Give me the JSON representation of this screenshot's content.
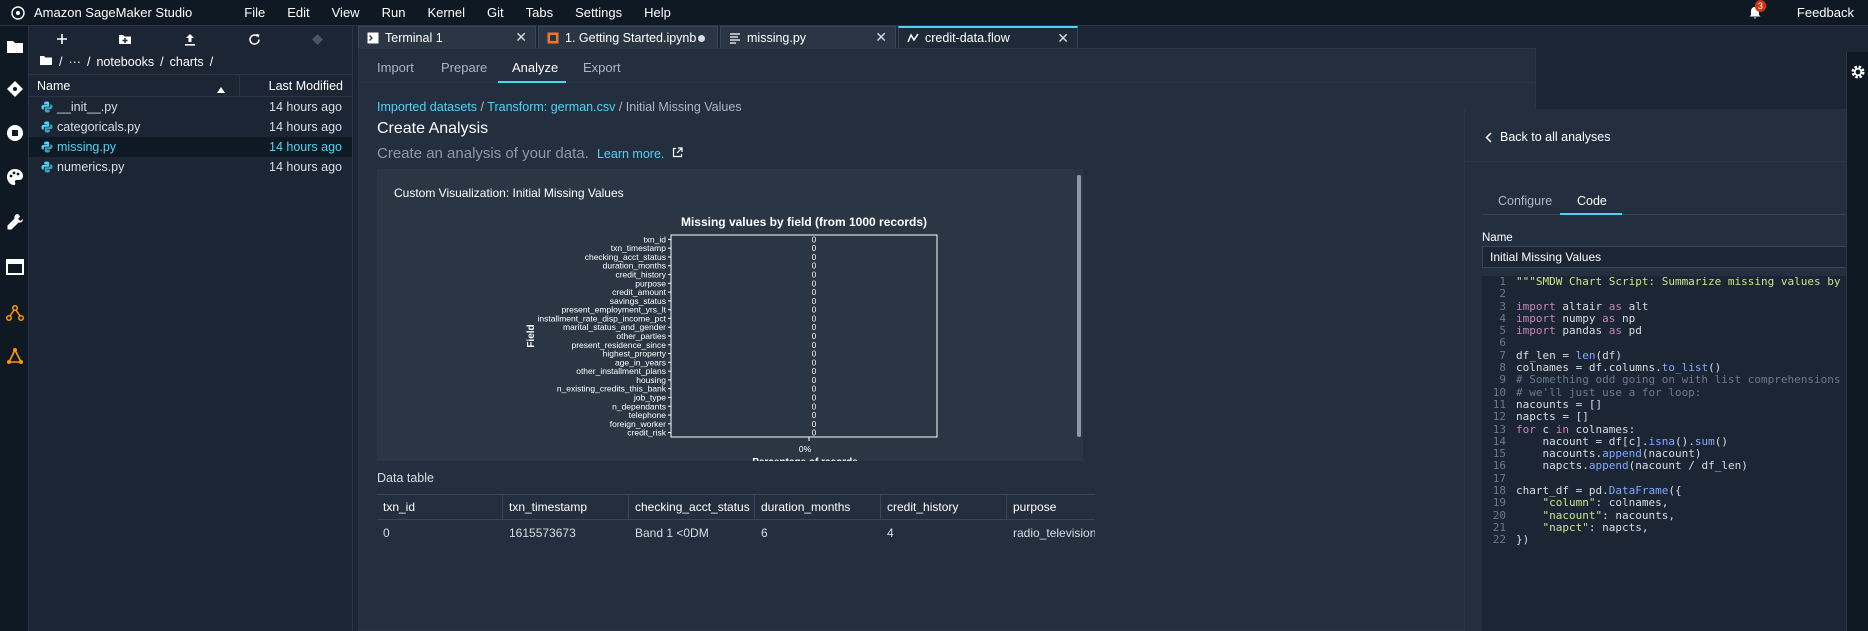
{
  "app": {
    "title": "Amazon SageMaker Studio",
    "feedback": "Feedback",
    "notifications": "3"
  },
  "menu": [
    "File",
    "Edit",
    "View",
    "Run",
    "Kernel",
    "Git",
    "Tabs",
    "Settings",
    "Help"
  ],
  "filebrowser": {
    "crumbs": [
      "/",
      "···",
      "/",
      "notebooks",
      "/",
      "charts",
      "/"
    ],
    "header": {
      "name": "Name",
      "modified": "Last Modified"
    },
    "files": [
      {
        "name": "__init__.py",
        "modified": "14 hours ago",
        "selected": false
      },
      {
        "name": "categoricals.py",
        "modified": "14 hours ago",
        "selected": false
      },
      {
        "name": "missing.py",
        "modified": "14 hours ago",
        "selected": true
      },
      {
        "name": "numerics.py",
        "modified": "14 hours ago",
        "selected": false
      }
    ]
  },
  "tabs": [
    {
      "label": "Terminal 1"
    },
    {
      "label": "1. Getting Started.ipynb"
    },
    {
      "label": "missing.py"
    },
    {
      "label": "credit-data.flow"
    }
  ],
  "flow": {
    "subtabs": [
      "Import",
      "Prepare",
      "Analyze",
      "Export"
    ],
    "breadcrumb": {
      "a": "Imported datasets",
      "b": "Transform: german.csv",
      "c": "Initial Missing Values"
    },
    "heading": "Create Analysis",
    "subheading": "Create an analysis of your data.",
    "learn_more": "Learn more.",
    "viz_title": "Custom Visualization: Initial Missing Values",
    "data_table_label": "Data table",
    "table": {
      "columns": [
        "txn_id",
        "txn_timestamp",
        "checking_acct_status",
        "duration_months",
        "credit_history",
        "purpose"
      ],
      "rows": [
        [
          "0",
          "1615573673",
          "Band 1 <0DM",
          "6",
          "4",
          "radio_television"
        ]
      ]
    }
  },
  "chart_data": {
    "type": "bar",
    "title": "Missing values by field (from 1000 records)",
    "xlabel": "Percentage of records",
    "ylabel": "Field",
    "xticks": [
      "0%"
    ],
    "categories": [
      "txn_id",
      "txn_timestamp",
      "checking_acct_status",
      "duration_months",
      "credit_history",
      "purpose",
      "credit_amount",
      "savings_status",
      "present_employment_yrs_lt",
      "installment_rate_disp_income_pct",
      "marital_status_and_gender",
      "other_parties",
      "present_residence_since",
      "highest_property",
      "age_in_years",
      "other_installment_plans",
      "housing",
      "n_existing_credits_this_bank",
      "job_type",
      "n_dependants",
      "telephone",
      "foreign_worker",
      "credit_risk"
    ],
    "values": [
      0,
      0,
      0,
      0,
      0,
      0,
      0,
      0,
      0,
      0,
      0,
      0,
      0,
      0,
      0,
      0,
      0,
      0,
      0,
      0,
      0,
      0,
      0
    ],
    "data_labels": [
      "0",
      "0",
      "0",
      "0",
      "0",
      "0",
      "0",
      "0",
      "0",
      "0",
      "0",
      "0",
      "0",
      "0",
      "0",
      "0",
      "0",
      "0",
      "0",
      "0",
      "0",
      "0",
      "0"
    ]
  },
  "analysis": {
    "back": "Back to all analyses",
    "tabs": [
      "Configure",
      "Code"
    ],
    "name_label": "Name",
    "name_value": "Initial Missing Values",
    "code": [
      "\"\"\"SMDW Chart Script: Summarize missing values by column\"\"\"",
      "",
      "import altair as alt",
      "import numpy as np",
      "import pandas as pd",
      "",
      "df_len = len(df)",
      "colnames = df.columns.to_list()",
      "# Something odd going on with list comprehensions throwing",
      "# we'll just use a for loop:",
      "nacounts = []",
      "napcts = []",
      "for c in colnames:",
      "    nacount = df[c].isna().sum()",
      "    nacounts.append(nacount)",
      "    napcts.append(nacount / df_len)",
      "",
      "chart_df = pd.DataFrame({",
      "    \"column\": colnames,",
      "    \"nacount\": nacounts,",
      "    \"napct\": napcts,",
      "})"
    ],
    "colors": {
      "keyword": "#c586c0",
      "string": "#c3e88d",
      "comment": "#6c7a8a",
      "fn": "#82aaff",
      "text": "#d8dde3"
    }
  }
}
